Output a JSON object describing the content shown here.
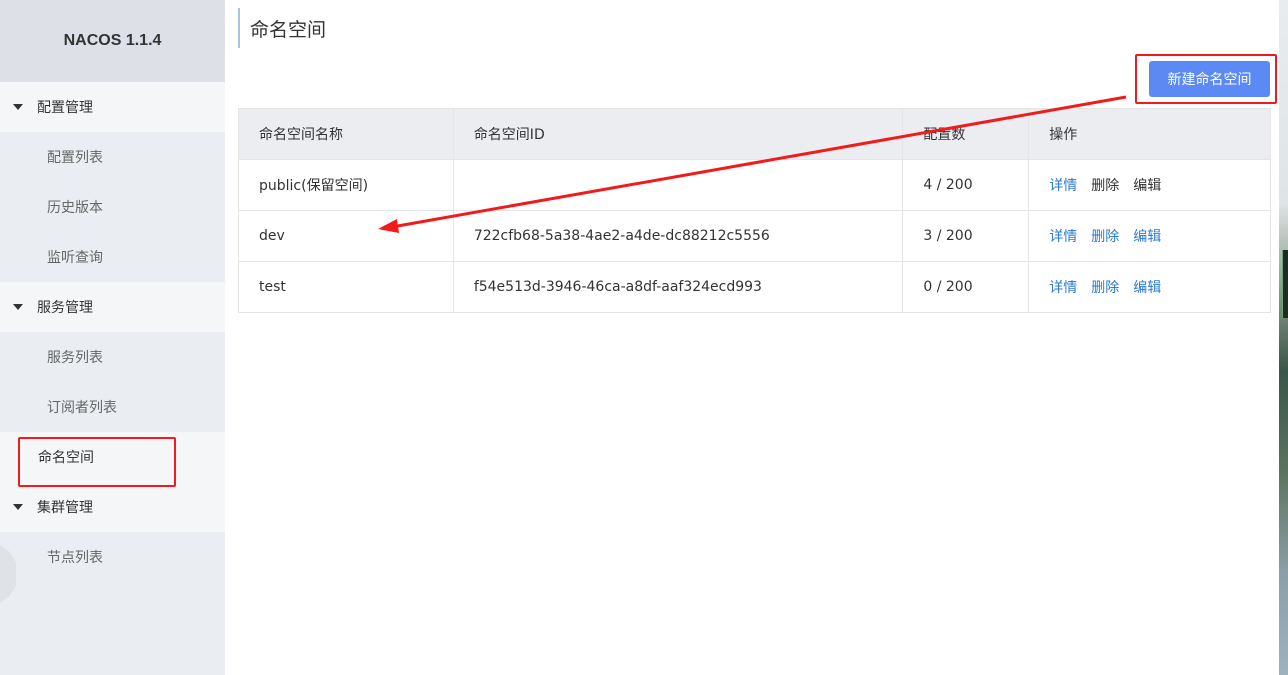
{
  "brand": "NACOS 1.1.4",
  "sidebar": {
    "groups": [
      {
        "label": "配置管理",
        "items": [
          "配置列表",
          "历史版本",
          "监听查询"
        ]
      },
      {
        "label": "服务管理",
        "items": [
          "服务列表",
          "订阅者列表"
        ]
      },
      {
        "label": "集群管理",
        "items": [
          "节点列表"
        ]
      }
    ],
    "active_item": "命名空间"
  },
  "page": {
    "title": "命名空间",
    "create_button": "新建命名空间"
  },
  "table": {
    "headers": [
      "命名空间名称",
      "命名空间ID",
      "配置数",
      "操作"
    ],
    "rows": [
      {
        "name": "public(保留空间)",
        "id": "",
        "count": "4 / 200",
        "ops": [
          "详情",
          "删除",
          "编辑"
        ]
      },
      {
        "name": "dev",
        "id": "722cfb68-5a38-4ae2-a4de-dc88212c5556",
        "count": "3 / 200",
        "ops": [
          "详情",
          "删除",
          "编辑"
        ]
      },
      {
        "name": "test",
        "id": "f54e513d-3946-46ca-a8df-aaf324ecd993",
        "count": "0 / 200",
        "ops": [
          "详情",
          "删除",
          "编辑"
        ]
      }
    ]
  },
  "colors": {
    "accent": "#5b8af5",
    "link": "#2b7bd0",
    "annotation": "#f21b1b"
  }
}
